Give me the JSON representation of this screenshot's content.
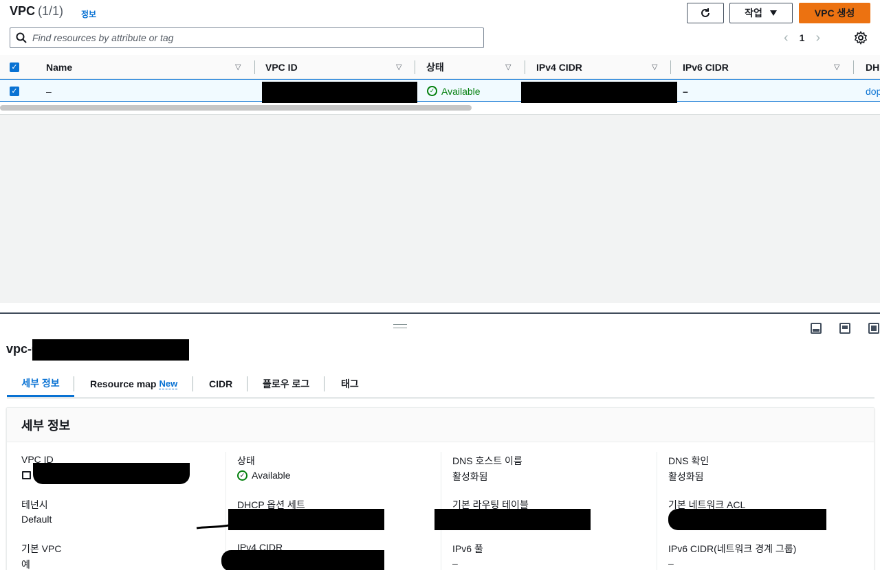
{
  "header": {
    "title": "VPC",
    "count": "(1/1)",
    "info": "정보",
    "actions_label": "작업",
    "create_label": "VPC 생성"
  },
  "search": {
    "placeholder": "Find resources by attribute or tag"
  },
  "pagination": {
    "page": "1"
  },
  "table": {
    "columns": [
      "Name",
      "VPC ID",
      "상태",
      "IPv4 CIDR",
      "IPv6 CIDR",
      "DH"
    ],
    "row": {
      "name": "–",
      "status": "Available",
      "ipv6_cidr": "–",
      "dhcp": "dop"
    }
  },
  "detail": {
    "title": "vpc-0",
    "tabs": [
      {
        "label": "세부 정보"
      },
      {
        "label": "Resource map",
        "badge": "New"
      },
      {
        "label": "CIDR"
      },
      {
        "label": "플로우 로그"
      },
      {
        "label": "태그"
      }
    ],
    "card_title": "세부 정보",
    "fields": {
      "vpc_id": {
        "label": "VPC ID"
      },
      "state": {
        "label": "상태",
        "value": "Available"
      },
      "dns_hostnames": {
        "label": "DNS 호스트 이름",
        "value": "활성화됨"
      },
      "dns_resolution": {
        "label": "DNS 확인",
        "value": "활성화됨"
      },
      "tenancy": {
        "label": "테넌시",
        "value": "Default"
      },
      "dhcp_options": {
        "label": "DHCP 옵션 세트"
      },
      "main_route_table": {
        "label": "기본 라우팅 테이블"
      },
      "main_network_acl": {
        "label": "기본 네트워크 ACL"
      },
      "default_vpc": {
        "label": "기본 VPC",
        "value": "예"
      },
      "ipv4_cidr": {
        "label": "IPv4 CIDR"
      },
      "ipv6_pool": {
        "label": "IPv6 풀",
        "value": "–"
      },
      "ipv6_cidr_group": {
        "label": "IPv6 CIDR(네트워크 경계 그룹)",
        "value": "–"
      }
    }
  },
  "colors": {
    "accent": "#0972d3",
    "primary_button": "#ec7211",
    "success": "#037f0c"
  }
}
